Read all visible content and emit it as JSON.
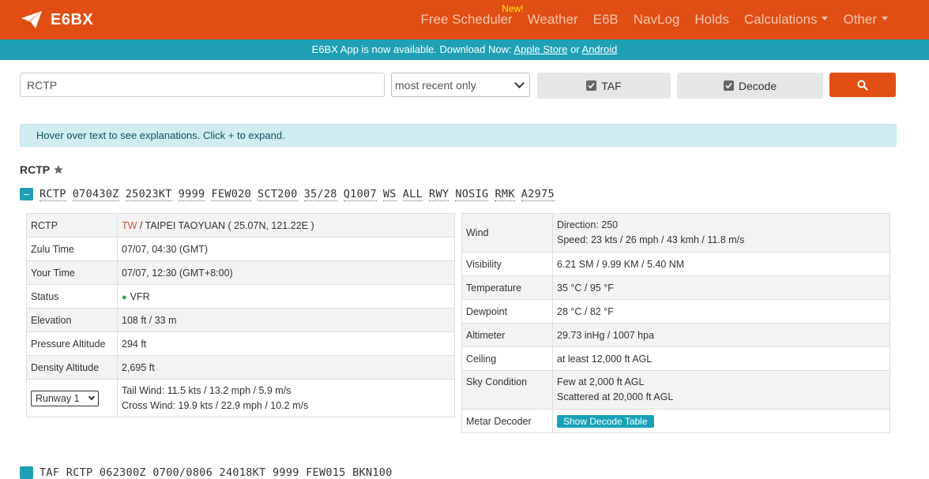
{
  "app": {
    "brand": "E6BX",
    "nav": [
      {
        "label": "Free Scheduler",
        "badge": "New!"
      },
      {
        "label": "Weather"
      },
      {
        "label": "E6B"
      },
      {
        "label": "NavLog"
      },
      {
        "label": "Holds"
      },
      {
        "label": "Calculations",
        "dropdown": true
      },
      {
        "label": "Other",
        "dropdown": true
      }
    ]
  },
  "banner": {
    "text": "E6BX App is now available. Download Now:",
    "link1": "Apple Store",
    "sep": "or",
    "link2": "Android"
  },
  "search": {
    "value": "RCTP",
    "period": "most recent only",
    "taf_label": "TAF",
    "decode_label": "Decode"
  },
  "info": "Hover over text to see explanations. Click + to expand.",
  "station": {
    "name": "RCTP"
  },
  "metar": {
    "collapse": "−",
    "tokens": [
      "RCTP",
      "070430Z",
      "25023KT",
      "9999",
      "FEW020",
      "SCT200",
      "35/28",
      "Q1007",
      "WS",
      "ALL",
      "RWY",
      "NOSIG",
      "RMK",
      "A2975"
    ]
  },
  "left_table": {
    "rows": [
      {
        "label": "RCTP",
        "country": "TW",
        "value": "/ TAIPEI TAOYUAN ( 25.07N, 121.22E )"
      },
      {
        "label": "Zulu Time",
        "value": "07/07, 04:30 (GMT)"
      },
      {
        "label": "Your Time",
        "value": "07/07, 12:30 (GMT+8:00)"
      },
      {
        "label": "Status",
        "value": "VFR"
      },
      {
        "label": "Elevation",
        "value": "108 ft / 33 m"
      },
      {
        "label": "Pressure Altitude",
        "value": "294 ft"
      },
      {
        "label": "Density Altitude",
        "value": "2,695 ft"
      }
    ],
    "runway": {
      "selected": "Runway 1",
      "tail": "Tail Wind: 11.5 kts / 13.2 mph / 5.9 m/s",
      "cross": "Cross Wind: 19.9 kts / 22.9 mph / 10.2 m/s"
    }
  },
  "right_table": {
    "wind": {
      "label": "Wind",
      "direction": "Direction: 250",
      "speed": "Speed: 23 kts / 26 mph / 43 kmh / 11.8 m/s"
    },
    "rows": [
      {
        "label": "Visibility",
        "value": "6.21 SM / 9.99 KM / 5.40 NM"
      },
      {
        "label": "Temperature",
        "value": "35 °C / 95 °F"
      },
      {
        "label": "Dewpoint",
        "value": "28 °C / 82 °F"
      },
      {
        "label": "Altimeter",
        "value": "29.73 inHg / 1007 hpa"
      },
      {
        "label": "Ceiling",
        "value": "at least 12,000 ft AGL"
      }
    ],
    "sky": {
      "label": "Sky Condition",
      "line1": "Few at 2,000 ft AGL",
      "line2": "Scattered at 20,000 ft AGL"
    },
    "decoder": {
      "label": "Metar Decoder",
      "button": "Show Decode Table"
    }
  },
  "taf": {
    "text": "TAF RCTP 062300Z 0700/0806 24018KT 9999 FEW015 BKN100"
  },
  "colors": {
    "brand": "#e04e14",
    "banner": "#1fa0b5",
    "info_bg": "#d1ecf1",
    "vfr": "#28a745"
  }
}
